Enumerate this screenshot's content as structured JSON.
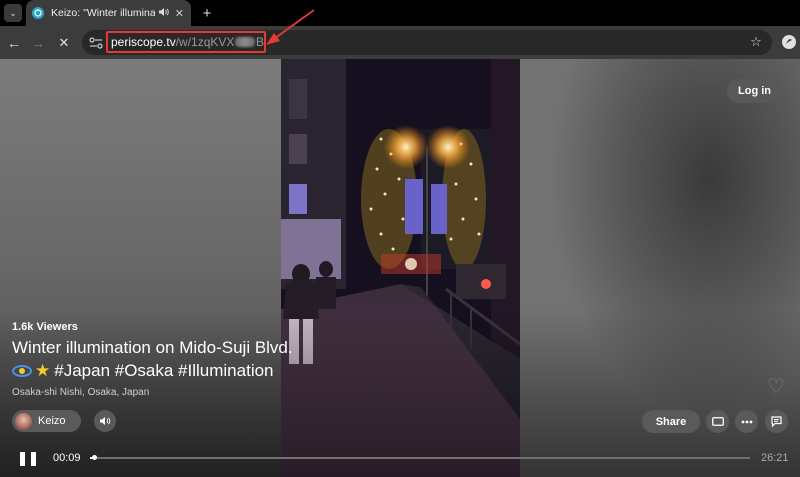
{
  "tab": {
    "title": "Keizo: \"Winter illumination",
    "favicon_icon": "periscope-icon",
    "audio_icon": "speaker-icon",
    "close_glyph": "✕"
  },
  "tabstrip": {
    "list_glyph": "⌄",
    "new_tab_glyph": "+"
  },
  "toolbar": {
    "back_glyph": "←",
    "forward_glyph": "→",
    "stop_glyph": "✕",
    "url_host": "periscope.tv",
    "url_path_start": "/w/1zqKVX",
    "url_path_end": "B",
    "star_glyph": "☆"
  },
  "page": {
    "login_label": "Log in",
    "viewers": "1.6k Viewers",
    "title": "Winter illumination on Mido-Suji Blvd.",
    "tags": "#Japan #Osaka #Illumination",
    "location": "Osaka-shi Nishi, Osaka, Japan",
    "username": "Keizo",
    "share_label": "Share",
    "heart_glyph": "♡"
  },
  "player": {
    "current_time": "00:09",
    "total_time": "26:21",
    "progress_fraction": 0.006
  },
  "colors": {
    "highlight": "#e53935",
    "tab_bg": "#3c3c3c",
    "omnibox_bg": "#282828",
    "pill_bg": "#5a5a5a"
  }
}
